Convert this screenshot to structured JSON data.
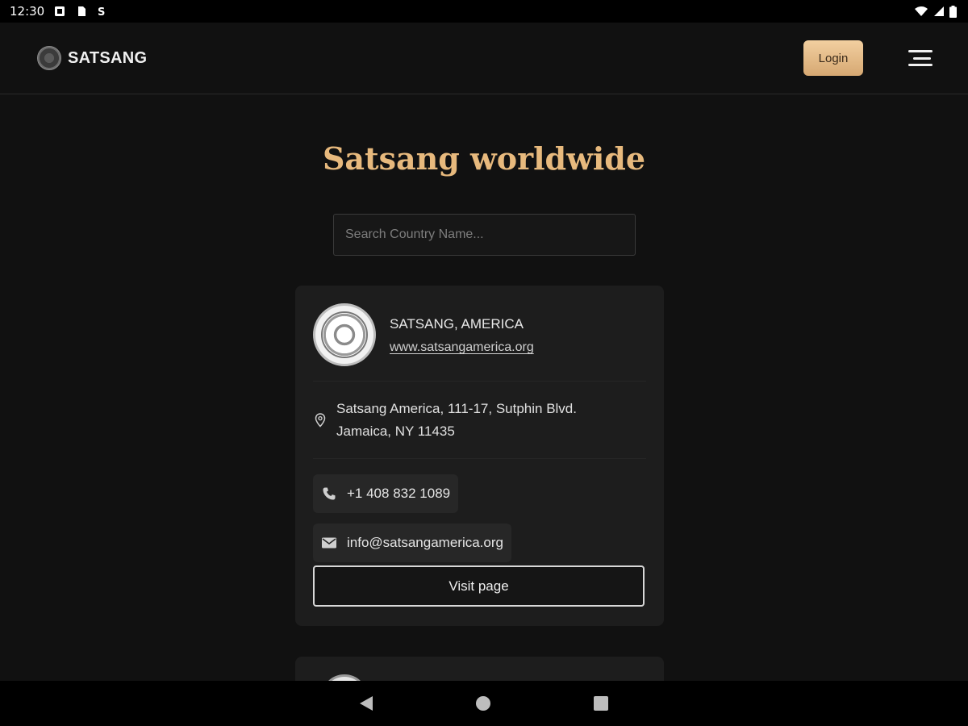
{
  "status_bar": {
    "time": "12:30"
  },
  "header": {
    "brand": "SATSANG",
    "login_label": "Login"
  },
  "page": {
    "title": "Satsang worldwide",
    "search_placeholder": "Search Country Name..."
  },
  "centers": [
    {
      "name": "SATSANG, AMERICA",
      "website": "www.satsangamerica.org",
      "address_line1": "Satsang America, 111-17, Sutphin Blvd.",
      "address_line2": "Jamaica, NY 11435",
      "phone": "+1 408 832 1089",
      "email": "info@satsangamerica.org",
      "visit_label": "Visit page"
    }
  ],
  "colors": {
    "accent": "#e7b97d",
    "background": "#111111",
    "card": "#1d1d1d"
  }
}
